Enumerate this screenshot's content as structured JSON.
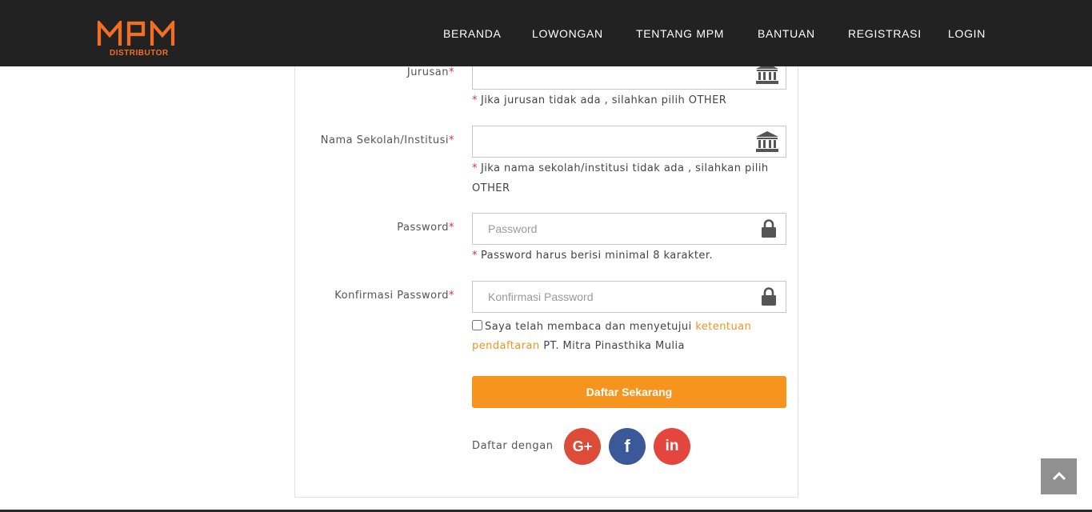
{
  "header": {
    "logo_text": "MPM",
    "logo_sub": "DISTRIBUTOR",
    "nav": [
      "BERANDA",
      "LOWONGAN",
      "TENTANG MPM",
      "BANTUAN",
      "REGISTRASI",
      "LOGIN"
    ]
  },
  "form": {
    "required_mark": "*",
    "jurusan": {
      "label": "Jurusan",
      "value": "",
      "hint": "Jika jurusan tidak ada , silahkan pilih OTHER",
      "icon": "institution-icon"
    },
    "sekolah": {
      "label": "Nama Sekolah/Institusi",
      "value": "",
      "hint_line1": "Jika nama sekolah/institusi tidak ada , silahkan pilih",
      "hint_line2": "OTHER",
      "icon": "institution-icon"
    },
    "password": {
      "label": "Password",
      "placeholder": "Password",
      "hint": "Password harus berisi minimal 8 karakter.",
      "icon": "lock-icon"
    },
    "confirm": {
      "label": "Konfirmasi Password",
      "placeholder": "Konfirmasi Password",
      "icon": "lock-icon"
    },
    "agreement": {
      "prefix": "Saya telah membaca dan menyetujui",
      "link_line1": "ketentuan",
      "link_line2": "pendaftaran",
      "suffix": "PT. Mitra Pinasthika Mulia",
      "checked": false
    },
    "submit_label": "Daftar Sekarang",
    "social_label": "Daftar dengan",
    "social": [
      {
        "name": "google-plus",
        "glyph": "G+",
        "color": "#dd4b39"
      },
      {
        "name": "facebook",
        "glyph": "f",
        "color": "#3b5998"
      },
      {
        "name": "linkedin",
        "glyph": "in",
        "color": "#e4453c"
      }
    ]
  },
  "colors": {
    "header_bg": "#222222",
    "accent": "#f7941d",
    "logo": "#f26f21",
    "required": "#d9323e"
  }
}
